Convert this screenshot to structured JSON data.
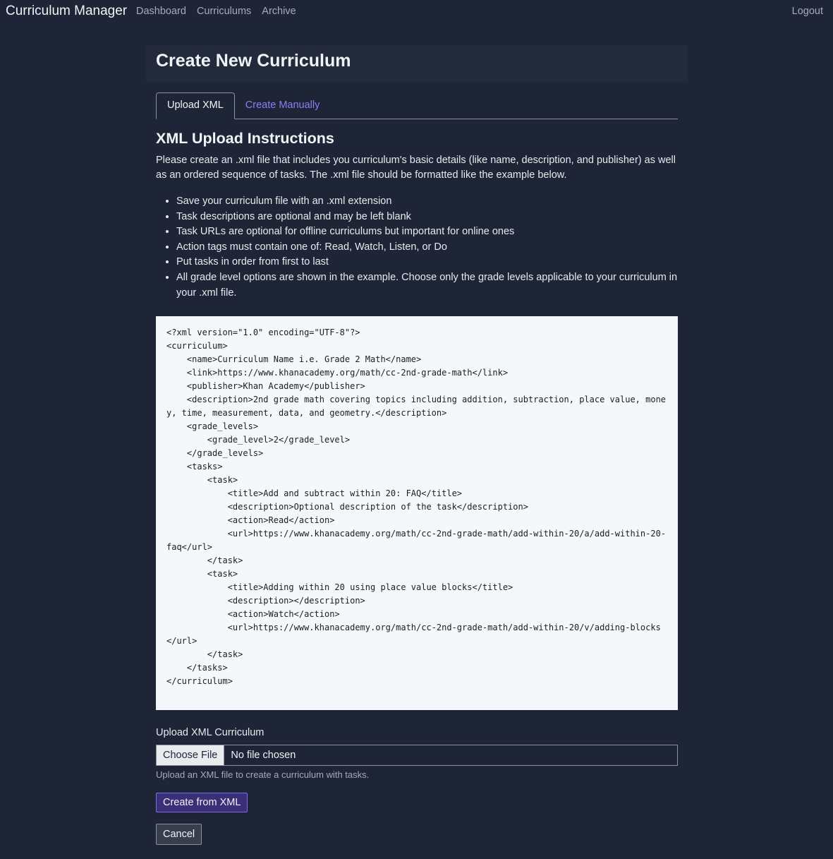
{
  "nav": {
    "brand": "Curriculum Manager",
    "links": [
      "Dashboard",
      "Curriculums",
      "Archive"
    ],
    "logout": "Logout"
  },
  "page": {
    "title": "Create New Curriculum"
  },
  "tabs": [
    {
      "label": "Upload XML",
      "active": true
    },
    {
      "label": "Create Manually",
      "active": false
    }
  ],
  "instructions": {
    "heading": "XML Upload Instructions",
    "paragraph": "Please create an .xml file that includes you curriculum's basic details (like name, description, and publisher) as well as an ordered sequence of tasks. The .xml file should be formatted like the example below.",
    "rules": [
      "Save your curriculum file with an .xml extension",
      "Task descriptions are optional and may be left blank",
      "Task URLs are optional for offline curriculums but important for online ones",
      "Action tags must contain one of: Read, Watch, Listen, or Do",
      "Put tasks in order from first to last",
      "All grade level options are shown in the example. Choose only the grade levels applicable to your curriculum in your .xml file."
    ],
    "example_xml": "<?xml version=\"1.0\" encoding=\"UTF-8\"?>\n<curriculum>\n    <name>Curriculum Name i.e. Grade 2 Math</name>\n    <link>https://www.khanacademy.org/math/cc-2nd-grade-math</link>\n    <publisher>Khan Academy</publisher>\n    <description>2nd grade math covering topics including addition, subtraction, place value, money, time, measurement, data, and geometry.</description>\n    <grade_levels>\n        <grade_level>2</grade_level>\n    </grade_levels>\n    <tasks>\n        <task>\n            <title>Add and subtract within 20: FAQ</title>\n            <description>Optional description of the task</description>\n            <action>Read</action>\n            <url>https://www.khanacademy.org/math/cc-2nd-grade-math/add-within-20/a/add-within-20-faq</url>\n        </task>\n        <task>\n            <title>Adding within 20 using place value blocks</title>\n            <description></description>\n            <action>Watch</action>\n            <url>https://www.khanacademy.org/math/cc-2nd-grade-math/add-within-20/v/adding-blocks</url>\n        </task>\n    </tasks>\n</curriculum>"
  },
  "upload": {
    "label": "Upload XML Curriculum",
    "choose_button": "Choose File",
    "status": "No file chosen",
    "help": "Upload an XML file to create a curriculum with tasks."
  },
  "actions": {
    "submit": "Create from XML",
    "cancel": "Cancel"
  },
  "colors": {
    "background": "#1e2537",
    "header_panel": "#222a3b",
    "tab_link": "#8f7cf7",
    "primary_button": "#3a2f78",
    "code_background": "#f5f8fa"
  }
}
